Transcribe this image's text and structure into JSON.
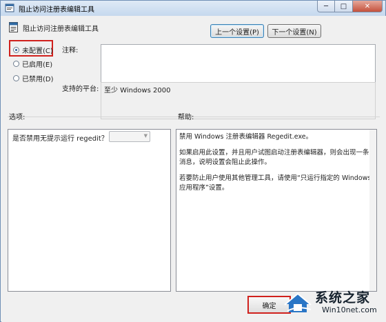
{
  "window": {
    "title": "阻止访问注册表编辑工具",
    "minimize_glyph": "─",
    "maximize_glyph": "□",
    "close_glyph": "✕"
  },
  "policy": {
    "name": "阻止访问注册表编辑工具",
    "prev_button": "上一个设置(P)",
    "next_button": "下一个设置(N)"
  },
  "state": {
    "options": [
      {
        "label": "未配置(C)",
        "selected": true
      },
      {
        "label": "已启用(E)",
        "selected": false
      },
      {
        "label": "已禁用(D)",
        "selected": false
      }
    ],
    "highlight_color": "#d0201c"
  },
  "comment": {
    "label": "注释:",
    "value": ""
  },
  "platform": {
    "label": "支持的平台:",
    "value": "至少 Windows 2000"
  },
  "options_section": {
    "header": "选项:",
    "option_text": "是否禁用无提示运行 regedit？",
    "combo_value": ""
  },
  "help_section": {
    "header": "帮助:",
    "paragraphs": [
      "禁用 Windows 注册表编辑器 Regedit.exe。",
      "如果启用此设置，并且用户试图启动注册表编辑器，则会出现一条消息，说明设置会阻止此操作。",
      "若要防止用户使用其他管理工具，请使用“只运行指定的 Windows 应用程序”设置。"
    ]
  },
  "footer": {
    "ok_button": "确定"
  },
  "watermark": {
    "name": "系统之家",
    "url": "Win10net.com"
  }
}
